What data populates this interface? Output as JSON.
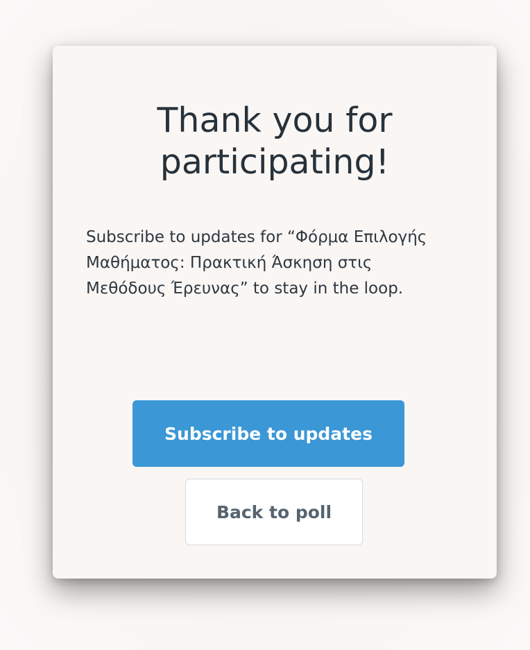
{
  "dialog": {
    "title": "Thank you for participating!",
    "message": "Subscribe to updates for “Φόρμα Επιλογής Μαθήματος: Πρακτική Άσκηση στις Μεθόδους Έρευνας” to stay in the loop.",
    "subscribe_label": "Subscribe to updates",
    "back_label": "Back to poll"
  },
  "colors": {
    "primary": "#3b97d6",
    "title_text": "#27313a",
    "secondary_text": "#566470",
    "card_background": "#f9f6f4"
  }
}
